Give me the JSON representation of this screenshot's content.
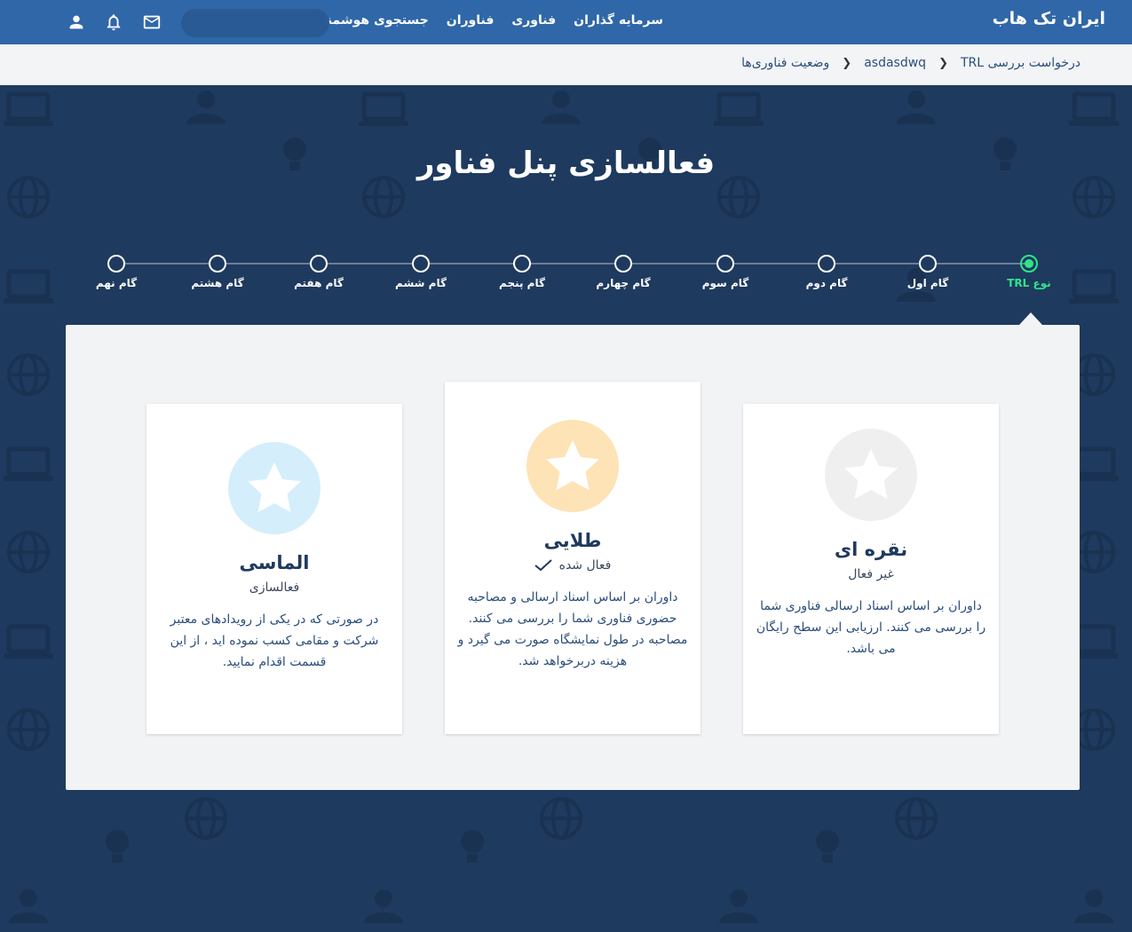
{
  "header": {
    "brand": "ایران تک هاب",
    "nav": [
      "جستجوی هوشمند",
      "فناوران",
      "فناوری",
      "سرمایه گذاران"
    ],
    "search_placeholder": "",
    "icons": [
      "mail-icon",
      "bell-icon",
      "user-icon"
    ]
  },
  "breadcrumb": {
    "items": [
      "وضعیت فناوری‌ها",
      "asdasdwq",
      "درخواست بررسی TRL"
    ]
  },
  "page": {
    "title": "فعالسازی پنل فناور"
  },
  "stepper": {
    "steps": [
      "نوع TRL",
      "گام اول",
      "گام دوم",
      "گام سوم",
      "گام چهارم",
      "گام پنجم",
      "گام ششم",
      "گام هفتم",
      "گام هشتم",
      "گام نهم"
    ],
    "active_index": 0
  },
  "plans": [
    {
      "key": "silver",
      "title": "نقره ای",
      "status": "غیر فعال",
      "description": "داوران بر اساس اسناد ارسالی فناوری شما را بررسی می کنند. ارزیابی این سطح رایگان می باشد.",
      "badge_color": "#efefef",
      "star_color": "#ffffff",
      "active": false
    },
    {
      "key": "gold",
      "title": "طلایی",
      "status": "فعال شده",
      "description": "داوران بر اساس اسناد ارسالی و مصاحبه حضوری فناوری شما را بررسی می کنند. مصاحبه در طول نمایشگاه صورت می گیرد و هزینه دربرخواهد شد.",
      "badge_color": "#fde3b5",
      "star_color": "#ffffff",
      "active": true
    },
    {
      "key": "diamond",
      "title": "الماسی",
      "status": "فعالسازی",
      "description": "در صورتی که در یکی از رویدادهای معتبر شرکت و مقامی کسب نموده اید ، از این قسمت اقدام نمایید.",
      "badge_color": "#d4eefb",
      "star_color": "#ffffff",
      "active": false
    }
  ],
  "colors": {
    "topbar": "#2f67a8",
    "hero": "#1f3a5f",
    "active_step": "#2ee58a"
  }
}
